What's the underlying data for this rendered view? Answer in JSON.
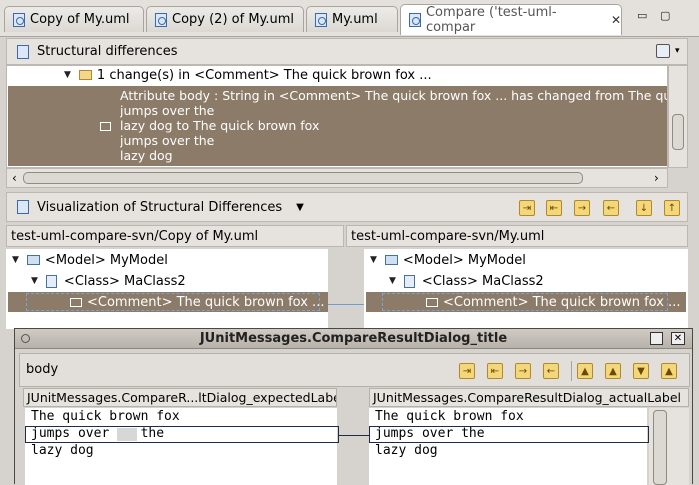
{
  "tabs": [
    {
      "label": "Copy of My.uml"
    },
    {
      "label": "Copy (2) of My.uml"
    },
    {
      "label": "My.uml"
    },
    {
      "label": "Compare ('test-uml-compar",
      "close": "✕"
    }
  ],
  "window_controls": {
    "minimize": "▭",
    "maximize": "▢"
  },
  "structural": {
    "title": "Structural differences",
    "change_row": "1 change(s) in <Comment> The quick brown fox ...",
    "detail_lines": [
      "Attribute body : String in <Comment> The quick brown fox ... has changed from The quic",
      "jumps over the",
      "lazy dog to The quick brown fox",
      "jumps over   the",
      "lazy dog"
    ],
    "scroll_left": "‹",
    "scroll_right": "›"
  },
  "visualization": {
    "title": "Visualization of Structural Differences",
    "left_path": "test-uml-compare-svn/Copy of My.uml",
    "right_path": "test-uml-compare-svn/My.uml",
    "left_tree": [
      {
        "label": "<Model> MyModel"
      },
      {
        "label": "<Class> MaClass2"
      },
      {
        "label": "<Comment> The quick brown fox ..."
      }
    ],
    "right_tree": [
      {
        "label": "<Model> MyModel"
      },
      {
        "label": "<Class> MaClass2"
      },
      {
        "label": "<Comment> The quick brown fox ..."
      }
    ]
  },
  "dialog": {
    "title": "JUnitMessages.CompareResultDialog_title",
    "field": "body",
    "expected_label": "JUnitMessages.CompareR...ltDialog_expectedLabel",
    "actual_label": "JUnitMessages.CompareResultDialog_actualLabel",
    "left_lines": [
      "The quick brown fox",
      "jumps over    the",
      "lazy dog"
    ],
    "right_lines": [
      "The quick brown fox",
      "jumps over the",
      "lazy dog"
    ]
  },
  "colors": {
    "selection": "#8c7b69",
    "accent": "#3c6aa6"
  }
}
